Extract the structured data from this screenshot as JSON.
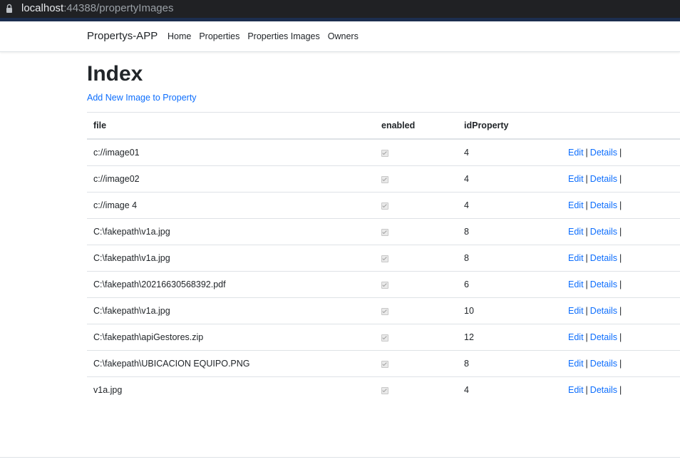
{
  "browser": {
    "url_host": "localhost",
    "url_rest": ":44388/propertyImages"
  },
  "navbar": {
    "brand": "Propertys-APP",
    "links": [
      "Home",
      "Properties",
      "Properties Images",
      "Owners"
    ]
  },
  "main": {
    "title": "Index",
    "add_link": "Add New Image to Property",
    "table": {
      "headers": [
        "file",
        "enabled",
        "idProperty",
        ""
      ],
      "edit_label": "Edit",
      "details_label": "Details",
      "separator": "|",
      "rows": [
        {
          "file": "c://image01",
          "enabled": true,
          "idProperty": "4"
        },
        {
          "file": "c://image02",
          "enabled": true,
          "idProperty": "4"
        },
        {
          "file": "c://image 4",
          "enabled": true,
          "idProperty": "4"
        },
        {
          "file": "C:\\fakepath\\v1a.jpg",
          "enabled": true,
          "idProperty": "8"
        },
        {
          "file": "C:\\fakepath\\v1a.jpg",
          "enabled": true,
          "idProperty": "8"
        },
        {
          "file": "C:\\fakepath\\20216630568392.pdf",
          "enabled": true,
          "idProperty": "6"
        },
        {
          "file": "C:\\fakepath\\v1a.jpg",
          "enabled": true,
          "idProperty": "10"
        },
        {
          "file": "C:\\fakepath\\apiGestores.zip",
          "enabled": true,
          "idProperty": "12"
        },
        {
          "file": "C:\\fakepath\\UBICACION EQUIPO.PNG",
          "enabled": true,
          "idProperty": "8"
        },
        {
          "file": "v1a.jpg",
          "enabled": true,
          "idProperty": "4"
        }
      ]
    }
  },
  "colors": {
    "link": "#0d6efd",
    "addressbar": "#202124",
    "accent": "#1c2e4f"
  }
}
